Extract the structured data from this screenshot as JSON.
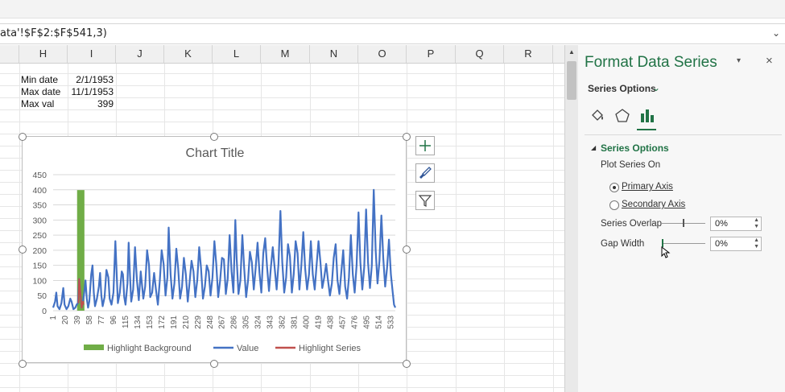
{
  "formula_bar": {
    "text": "ata'!$F$2:$F$541,3)"
  },
  "columns": [
    "H",
    "I",
    "J",
    "K",
    "L",
    "M",
    "N",
    "O",
    "P",
    "Q",
    "R"
  ],
  "cells": {
    "min_date_label": "Min date",
    "min_date_value": "2/1/1953",
    "max_date_label": "Max date",
    "max_date_value": "11/1/1953",
    "max_val_label": "Max val",
    "max_val_value": "399"
  },
  "chart": {
    "title": "Chart Title"
  },
  "chart_data": {
    "type": "line",
    "title": "Chart Title",
    "xlabel": "",
    "ylabel": "",
    "ylim": [
      0,
      450
    ],
    "y_ticks": [
      0,
      50,
      100,
      150,
      200,
      250,
      300,
      350,
      400,
      450
    ],
    "x_tick_labels": [
      "1",
      "20",
      "39",
      "58",
      "77",
      "96",
      "115",
      "134",
      "153",
      "172",
      "191",
      "210",
      "229",
      "248",
      "267",
      "286",
      "305",
      "324",
      "343",
      "362",
      "381",
      "400",
      "419",
      "438",
      "457",
      "476",
      "495",
      "514",
      "533"
    ],
    "x_range": [
      1,
      540
    ],
    "gridlines": true,
    "legend_position": "bottom",
    "series": [
      {
        "name": "Highlight Background",
        "kind": "bar",
        "color": "#70ad47",
        "points": [
          [
            40,
            399
          ],
          [
            41,
            399
          ],
          [
            42,
            399
          ],
          [
            43,
            399
          ],
          [
            44,
            399
          ],
          [
            45,
            399
          ],
          [
            46,
            399
          ],
          [
            47,
            399
          ],
          [
            48,
            399
          ],
          [
            49,
            399
          ]
        ]
      },
      {
        "name": "Value",
        "kind": "line",
        "color": "#4472c4",
        "points": [
          [
            1,
            10
          ],
          [
            4,
            30
          ],
          [
            6,
            60
          ],
          [
            8,
            15
          ],
          [
            11,
            5
          ],
          [
            14,
            25
          ],
          [
            17,
            75
          ],
          [
            19,
            20
          ],
          [
            22,
            5
          ],
          [
            25,
            15
          ],
          [
            28,
            40
          ],
          [
            30,
            30
          ],
          [
            33,
            5
          ],
          [
            36,
            10
          ],
          [
            38,
            20
          ],
          [
            40,
            25
          ],
          [
            42,
            105
          ],
          [
            44,
            55
          ],
          [
            46,
            10
          ],
          [
            48,
            30
          ],
          [
            50,
            60
          ],
          [
            52,
            100
          ],
          [
            54,
            40
          ],
          [
            56,
            10
          ],
          [
            58,
            30
          ],
          [
            61,
            120
          ],
          [
            63,
            150
          ],
          [
            65,
            60
          ],
          [
            67,
            15
          ],
          [
            70,
            40
          ],
          [
            73,
            80
          ],
          [
            75,
            125
          ],
          [
            77,
            50
          ],
          [
            79,
            15
          ],
          [
            82,
            45
          ],
          [
            85,
            135
          ],
          [
            88,
            110
          ],
          [
            90,
            40
          ],
          [
            93,
            20
          ],
          [
            96,
            60
          ],
          [
            99,
            230
          ],
          [
            101,
            130
          ],
          [
            103,
            25
          ],
          [
            106,
            60
          ],
          [
            109,
            130
          ],
          [
            111,
            120
          ],
          [
            113,
            45
          ],
          [
            115,
            20
          ],
          [
            118,
            90
          ],
          [
            120,
            225
          ],
          [
            122,
            120
          ],
          [
            124,
            30
          ],
          [
            127,
            70
          ],
          [
            130,
            210
          ],
          [
            133,
            100
          ],
          [
            136,
            35
          ],
          [
            139,
            130
          ],
          [
            141,
            85
          ],
          [
            143,
            40
          ],
          [
            146,
            80
          ],
          [
            149,
            200
          ],
          [
            152,
            150
          ],
          [
            154,
            45
          ],
          [
            157,
            60
          ],
          [
            160,
            125
          ],
          [
            163,
            70
          ],
          [
            166,
            20
          ],
          [
            169,
            100
          ],
          [
            172,
            200
          ],
          [
            175,
            155
          ],
          [
            178,
            50
          ],
          [
            181,
            110
          ],
          [
            183,
            275
          ],
          [
            186,
            120
          ],
          [
            189,
            40
          ],
          [
            192,
            90
          ],
          [
            195,
            205
          ],
          [
            198,
            140
          ],
          [
            201,
            40
          ],
          [
            204,
            80
          ],
          [
            207,
            175
          ],
          [
            210,
            120
          ],
          [
            213,
            30
          ],
          [
            216,
            95
          ],
          [
            219,
            165
          ],
          [
            222,
            130
          ],
          [
            225,
            45
          ],
          [
            228,
            100
          ],
          [
            231,
            210
          ],
          [
            234,
            140
          ],
          [
            237,
            40
          ],
          [
            240,
            80
          ],
          [
            243,
            150
          ],
          [
            246,
            130
          ],
          [
            249,
            50
          ],
          [
            252,
            110
          ],
          [
            255,
            230
          ],
          [
            258,
            155
          ],
          [
            261,
            45
          ],
          [
            264,
            100
          ],
          [
            267,
            175
          ],
          [
            270,
            170
          ],
          [
            273,
            55
          ],
          [
            276,
            105
          ],
          [
            279,
            250
          ],
          [
            282,
            130
          ],
          [
            285,
            60
          ],
          [
            288,
            300
          ],
          [
            290,
            175
          ],
          [
            293,
            55
          ],
          [
            296,
            100
          ],
          [
            299,
            250
          ],
          [
            302,
            140
          ],
          [
            305,
            45
          ],
          [
            308,
            100
          ],
          [
            311,
            195
          ],
          [
            314,
            160
          ],
          [
            317,
            70
          ],
          [
            320,
            140
          ],
          [
            323,
            225
          ],
          [
            326,
            125
          ],
          [
            329,
            60
          ],
          [
            332,
            190
          ],
          [
            335,
            240
          ],
          [
            338,
            145
          ],
          [
            341,
            65
          ],
          [
            344,
            145
          ],
          [
            347,
            210
          ],
          [
            350,
            140
          ],
          [
            353,
            70
          ],
          [
            356,
            155
          ],
          [
            359,
            330
          ],
          [
            362,
            160
          ],
          [
            365,
            60
          ],
          [
            368,
            110
          ],
          [
            371,
            220
          ],
          [
            374,
            180
          ],
          [
            377,
            60
          ],
          [
            380,
            120
          ],
          [
            383,
            230
          ],
          [
            386,
            190
          ],
          [
            389,
            70
          ],
          [
            392,
            150
          ],
          [
            395,
            260
          ],
          [
            398,
            140
          ],
          [
            401,
            70
          ],
          [
            404,
            120
          ],
          [
            407,
            230
          ],
          [
            410,
            120
          ],
          [
            413,
            70
          ],
          [
            416,
            150
          ],
          [
            419,
            230
          ],
          [
            422,
            160
          ],
          [
            425,
            75
          ],
          [
            428,
            110
          ],
          [
            431,
            155
          ],
          [
            434,
            100
          ],
          [
            437,
            50
          ],
          [
            440,
            90
          ],
          [
            443,
            175
          ],
          [
            446,
            220
          ],
          [
            449,
            100
          ],
          [
            452,
            55
          ],
          [
            455,
            130
          ],
          [
            458,
            200
          ],
          [
            461,
            80
          ],
          [
            464,
            40
          ],
          [
            467,
            110
          ],
          [
            470,
            250
          ],
          [
            473,
            120
          ],
          [
            476,
            60
          ],
          [
            479,
            150
          ],
          [
            482,
            325
          ],
          [
            485,
            160
          ],
          [
            488,
            70
          ],
          [
            491,
            145
          ],
          [
            494,
            335
          ],
          [
            497,
            160
          ],
          [
            500,
            75
          ],
          [
            503,
            150
          ],
          [
            506,
            400
          ],
          [
            509,
            200
          ],
          [
            512,
            90
          ],
          [
            515,
            165
          ],
          [
            518,
            315
          ],
          [
            521,
            175
          ],
          [
            524,
            80
          ],
          [
            527,
            140
          ],
          [
            530,
            235
          ],
          [
            533,
            120
          ],
          [
            536,
            60
          ],
          [
            538,
            20
          ],
          [
            540,
            10
          ]
        ]
      },
      {
        "name": "Highlight Series",
        "kind": "line",
        "color": "#c0504d",
        "points": [
          [
            41,
            25
          ],
          [
            42,
            105
          ],
          [
            44,
            55
          ],
          [
            46,
            10
          ],
          [
            48,
            30
          ],
          [
            49,
            20
          ]
        ]
      }
    ]
  },
  "pane": {
    "title": "Format Data Series",
    "series_options_dropdown": "Series Options",
    "section_title": "Series Options",
    "plot_series_on": "Plot Series On",
    "primary_axis_label": "Primary Axis",
    "secondary_axis_label": "Secondary Axis",
    "primary_selected": true,
    "series_overlap_label": "Series Overlap",
    "series_overlap_value": "0%",
    "series_overlap_level": 0,
    "gap_width_label": "Gap Width",
    "gap_width_value": "0%",
    "gap_width_level": 0
  },
  "colors": {
    "accent": "#217346",
    "value": "#4472c4",
    "highlight_bg": "#70ad47",
    "highlight_series": "#c0504d"
  }
}
